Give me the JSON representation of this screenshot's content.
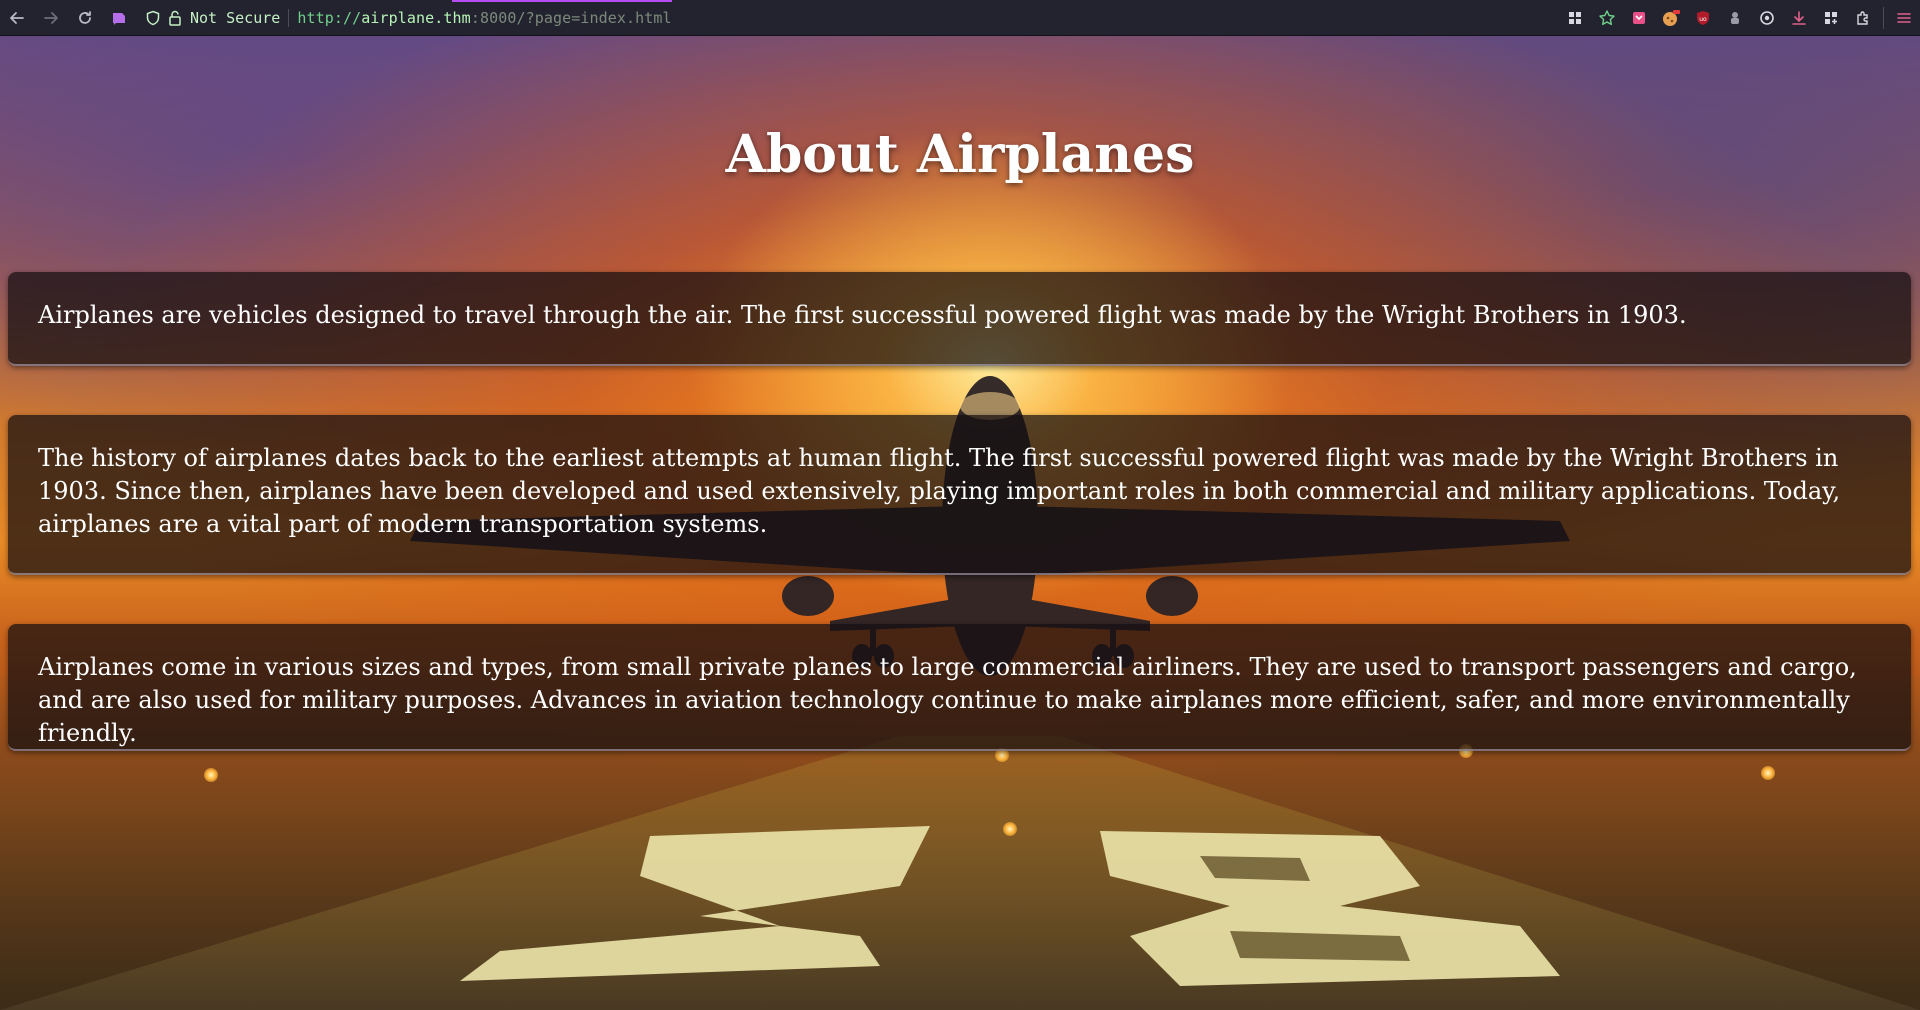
{
  "browser": {
    "security_label": "Not Secure",
    "url": {
      "scheme": "http://",
      "host": "airplane.thm",
      "rest": ":8000/?page=index.html"
    },
    "nav_icons": [
      "back-icon",
      "forward-icon",
      "reload-icon",
      "container-icon"
    ],
    "toolbar_icons": [
      "grid-icon",
      "bookmark-star-icon",
      "pocket-icon",
      "cookie-icon",
      "ublock-icon",
      "extension-bug-icon",
      "settings-gear-icon",
      "download-icon",
      "apps-icon",
      "extensions-puzzle-icon",
      "menu-icon"
    ],
    "accent_color": "#b54df2",
    "url_color": "#6fd08a"
  },
  "page": {
    "title": "About Airplanes",
    "sections": [
      "Airplanes are vehicles designed to travel through the air. The first successful powered flight was made by the Wright Brothers in 1903.",
      "The history of airplanes dates back to the earliest attempts at human flight. The first successful powered flight was made by the Wright Brothers in 1903. Since then, airplanes have been developed and used extensively, playing important roles in both commercial and military applications. Today, airplanes are a vital part of modern transportation systems.",
      "Airplanes come in various sizes and types, from small private planes to large commercial airliners. They are used to transport passengers and cargo, and are also used for military purposes. Advances in aviation technology continue to make airplanes more efficient, safer, and more environmentally friendly."
    ],
    "background_image": "airplane-sunset-runway",
    "runway_number": "28"
  }
}
